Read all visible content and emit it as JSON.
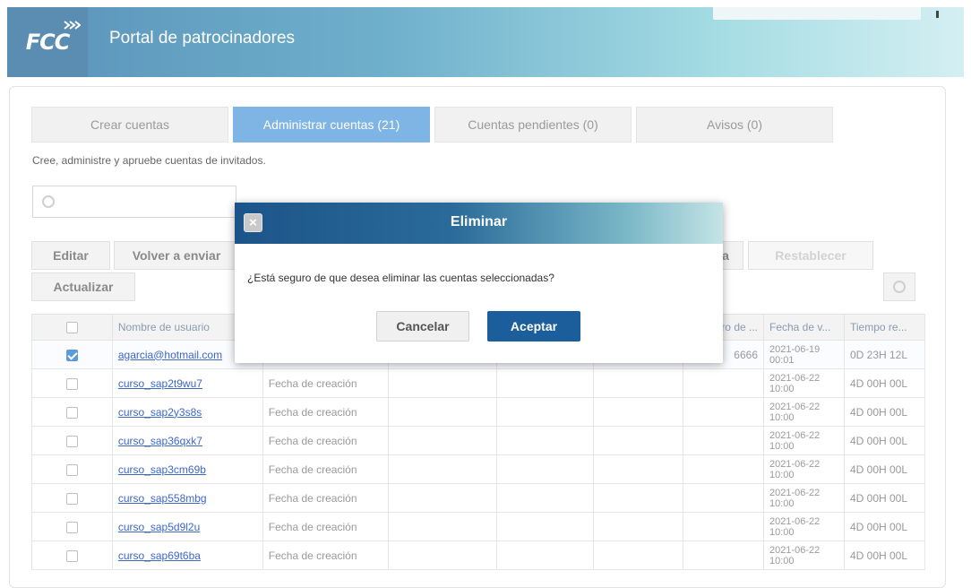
{
  "header": {
    "logo_text": "FCC",
    "title": "Portal de patrocinadores"
  },
  "tabs": [
    {
      "label": "Crear cuentas"
    },
    {
      "label": "Administrar cuentas (21)"
    },
    {
      "label": "Cuentas pendientes (0)"
    },
    {
      "label": "Avisos (0)"
    }
  ],
  "subtitle": "Cree, administre y apruebe cuentas de invitados.",
  "toolbar": {
    "edit": "Editar",
    "resend": "Volver a enviar",
    "partial_hidden": "a",
    "reset": "Restablecer",
    "update": "Actualizar"
  },
  "table": {
    "headers": [
      "Nombre de usuario",
      "ro de ...",
      "Fecha de v...",
      "Tiempo re..."
    ],
    "rows": [
      {
        "checked": true,
        "user": "agarcia@hotmail.com",
        "created": "",
        "phone": "6666",
        "date1": "2021-06-19",
        "date2": "00:01",
        "time": "0D 23H 12L"
      },
      {
        "checked": false,
        "user": "curso_sap2t9wu7",
        "created": "Fecha de creación",
        "phone": "",
        "date1": "2021-06-22",
        "date2": "10:00",
        "time": "4D 00H 00L"
      },
      {
        "checked": false,
        "user": "curso_sap2y3s8s",
        "created": "Fecha de creación",
        "phone": "",
        "date1": "2021-06-22",
        "date2": "10:00",
        "time": "4D 00H 00L"
      },
      {
        "checked": false,
        "user": "curso_sap36qxk7",
        "created": "Fecha de creación",
        "phone": "",
        "date1": "2021-06-22",
        "date2": "10:00",
        "time": "4D 00H 00L"
      },
      {
        "checked": false,
        "user": "curso_sap3cm69b",
        "created": "Fecha de creación",
        "phone": "",
        "date1": "2021-06-22",
        "date2": "10:00",
        "time": "4D 00H 00L"
      },
      {
        "checked": false,
        "user": "curso_sap558mbg",
        "created": "Fecha de creación",
        "phone": "",
        "date1": "2021-06-22",
        "date2": "10:00",
        "time": "4D 00H 00L"
      },
      {
        "checked": false,
        "user": "curso_sap5d9l2u",
        "created": "Fecha de creación",
        "phone": "",
        "date1": "2021-06-22",
        "date2": "10:00",
        "time": "4D 00H 00L"
      },
      {
        "checked": false,
        "user": "curso_sap69t6ba",
        "created": "Fecha de creación",
        "phone": "",
        "date1": "2021-06-22",
        "date2": "10:00",
        "time": "4D 00H 00L"
      }
    ]
  },
  "modal": {
    "title": "Eliminar",
    "close_glyph": "×",
    "message": "¿Está seguro de que desea eliminar las cuentas seleccionadas?",
    "cancel": "Cancelar",
    "ok": "Aceptar"
  }
}
